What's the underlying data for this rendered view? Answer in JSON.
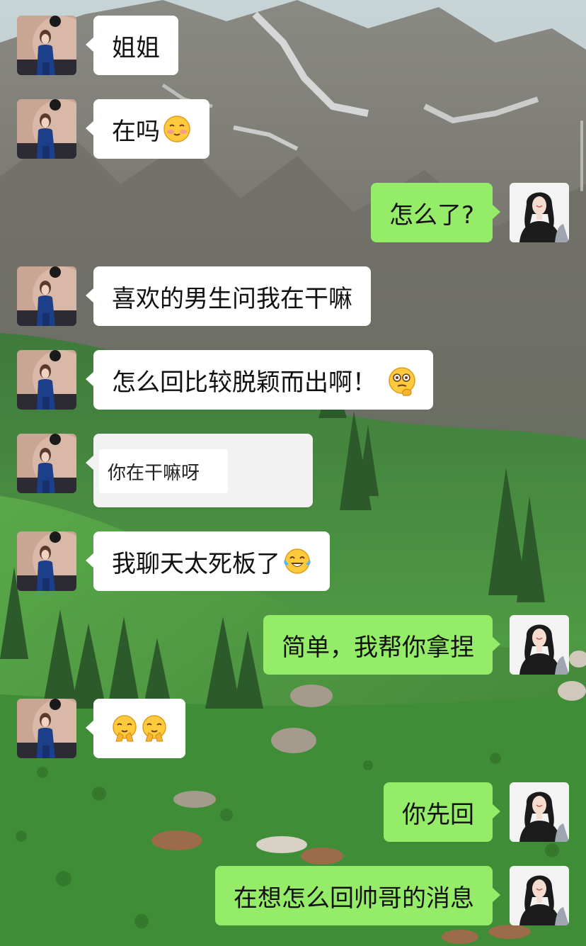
{
  "chat": {
    "messages": [
      {
        "side": "in",
        "text": "姐姐",
        "emoji": []
      },
      {
        "side": "in",
        "text": "在吗",
        "emoji": [
          "blushing-face"
        ]
      },
      {
        "side": "out",
        "text": "怎么了?",
        "emoji": []
      },
      {
        "side": "in",
        "text": "喜欢的男生问我在干嘛",
        "emoji": []
      },
      {
        "side": "in",
        "text": "怎么回比较脱颖而出啊！",
        "emoji": [
          "thinking-face"
        ]
      },
      {
        "side": "in",
        "type": "card",
        "text": "你在干嘛呀",
        "emoji": []
      },
      {
        "side": "in",
        "text": "我聊天太死板了",
        "emoji": [
          "tears-of-joy-face"
        ]
      },
      {
        "side": "out",
        "text": "简单，我帮你拿捏",
        "emoji": []
      },
      {
        "side": "in",
        "text": "",
        "emoji": [
          "pleading-hands-face",
          "pleading-hands-face"
        ]
      },
      {
        "side": "out",
        "text": "你先回",
        "emoji": []
      },
      {
        "side": "out",
        "text": "在想怎么回帅哥的消息",
        "emoji": []
      }
    ]
  },
  "colors": {
    "incoming_bubble": "#ffffff",
    "outgoing_bubble": "#95ec69",
    "text": "#111111"
  }
}
